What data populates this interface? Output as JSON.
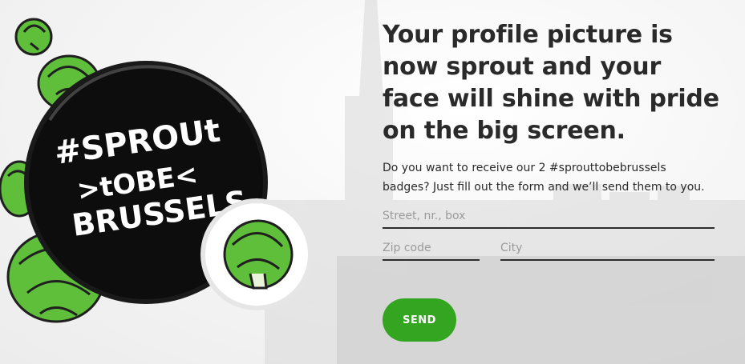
{
  "headline": "Your profile picture is now sprout and your face will shine with pride on the big screen.",
  "intro": "Do you want to receive our 2 #sprouttobebrussels badges? Just fill out the form and we’ll send them to you.",
  "badge": {
    "line1": "#SPROUt",
    "line2": ">tOBE<",
    "line3": "BRUSSELS"
  },
  "form": {
    "street_placeholder": "Street, nr., box",
    "zip_placeholder": "Zip code",
    "city_placeholder": "City",
    "send_label": "SEND"
  },
  "colors": {
    "accent": "#34a521",
    "badge_black": "#0d0d0d",
    "sprout_green": "#5fbf3a"
  },
  "icons": [
    "sprout-icon",
    "badge-icon"
  ]
}
